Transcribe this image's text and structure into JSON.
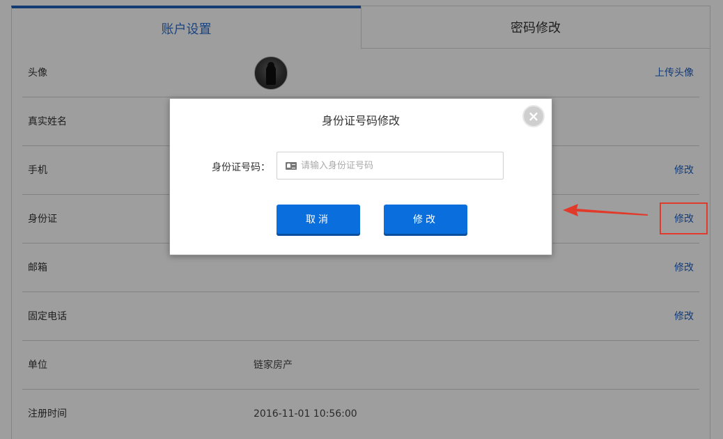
{
  "tabs": {
    "account": "账户设置",
    "password": "密码修改"
  },
  "rows": [
    {
      "label": "头像",
      "value": "",
      "action": "上传头像"
    },
    {
      "label": "真实姓名",
      "value": "",
      "action": ""
    },
    {
      "label": "手机",
      "value": "",
      "action": "修改"
    },
    {
      "label": "身份证",
      "value": "",
      "action": "修改"
    },
    {
      "label": "邮箱",
      "value": "",
      "action": "修改"
    },
    {
      "label": "固定电话",
      "value": "",
      "action": "修改"
    },
    {
      "label": "单位",
      "value": "链家房产",
      "action": ""
    },
    {
      "label": "注册时间",
      "value": "2016-11-01 10:56:00",
      "action": ""
    }
  ],
  "modal": {
    "title": "身份证号码修改",
    "close": "×",
    "field_label": "身份证号码：",
    "input_placeholder": "请输入身份证号码",
    "input_value": "",
    "cancel": "取消",
    "confirm": "修改"
  },
  "annotation": {
    "highlight_color": "#e23a2a"
  },
  "colors": {
    "accent": "#0a6fdc",
    "link": "#1f5fbf",
    "tab_active": "#2a6fd0"
  }
}
